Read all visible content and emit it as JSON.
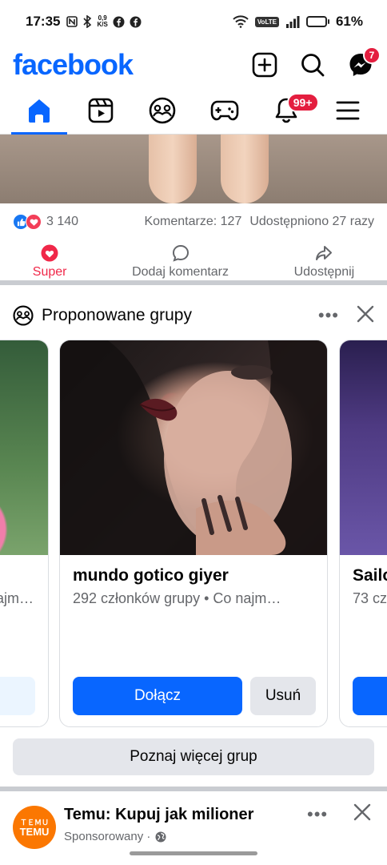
{
  "status_bar": {
    "time": "17:35",
    "net_speed_top": "0,9",
    "net_speed_bottom": "K/S",
    "volte": "VoLTE",
    "battery": "61%",
    "battery_level": 0.61
  },
  "header": {
    "logo": "facebook",
    "messenger_badge": "7"
  },
  "nav": {
    "notifications_badge": "99+"
  },
  "post": {
    "reaction_count": "3 140",
    "comments": "Komentarze: 127",
    "shares": "Udostępniono 27 razy",
    "actions": {
      "react": "Super",
      "comment": "Dodaj komentarz",
      "share": "Udostępnij"
    }
  },
  "suggested_groups": {
    "title": "Proponowane grupy",
    "more": "•••",
    "cards": [
      {
        "name": "",
        "meta": "ajm…"
      },
      {
        "name": "mundo gotico giyer",
        "meta": "292 członków grupy • Co najm…",
        "join": "Dołącz",
        "remove": "Usuń"
      },
      {
        "name": "Sailo",
        "meta": "73 cz"
      }
    ],
    "see_more": "Poznaj więcej grup"
  },
  "sponsored_post": {
    "avatar_text_top": "ＴＥＭＵ",
    "avatar_text": "TEMU",
    "title": "Temu: Kupuj jak milioner",
    "subtitle": "Sponsorowany ·"
  },
  "colors": {
    "brand": "#0866ff",
    "badge": "#e41e3f",
    "super": "#f02849",
    "temu": "#fb7701"
  }
}
